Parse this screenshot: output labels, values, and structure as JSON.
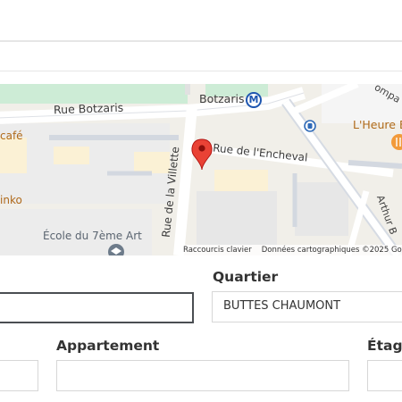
{
  "map": {
    "streets": {
      "botzaris": "Rue Botzaris",
      "encheval": "Rue de l'Encheval",
      "villette": "Rue de la Villette",
      "arthur": "Arthur B"
    },
    "places": {
      "metro": "Botzaris",
      "cafe": "café",
      "inko": "inko",
      "ecole": "École du 7ème Art",
      "heure": "L'Heure B",
      "ompa": "ompa"
    },
    "metro_badge": "M",
    "attribution": {
      "shortcuts": "Raccourcis clavier",
      "data": "Données cartographiques ©2025 Goo"
    },
    "icons": [
      "metro-icon",
      "bus-stop-icon",
      "restaurant-icon",
      "location-pin-icon",
      "school-icon"
    ]
  },
  "form": {
    "quartier_label": "Quartier",
    "quartier_value": "BUTTES CHAUMONT",
    "appartement_label": "Appartement",
    "etage_label": "Étage"
  },
  "colors": {
    "pin": "#e94235",
    "metro": "#1e56b0",
    "park": "#c9ebd4",
    "focus_border": "#4a4e52"
  }
}
